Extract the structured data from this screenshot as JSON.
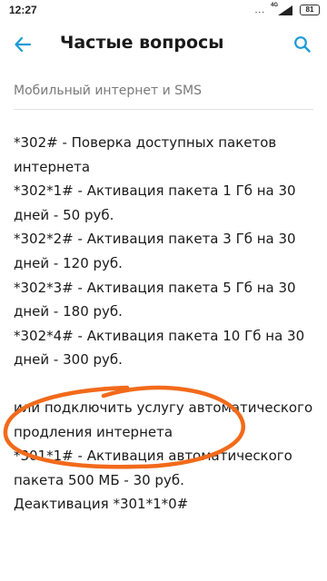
{
  "status_bar": {
    "time": "12:27",
    "dots": "...",
    "network": "4G",
    "battery": "81"
  },
  "header": {
    "title": "Частые вопросы",
    "back_icon": "arrow-left-icon",
    "search_icon": "search-icon",
    "accent_color": "#1a9bd7"
  },
  "section_title": "Мобильный интернет и SMS",
  "faq": {
    "block1": [
      "*302# - Поверка доступных пакетов интернета",
      "*302*1# - Активация пакета 1 Гб на 30 дней - 50 руб.",
      "*302*2# - Активация пакета 3 Гб на 30 дней - 120 руб.",
      "*302*3# - Активация пакета 5 Гб на 30 дней - 180 руб.",
      "*302*4# - Активация пакета 10 Гб на 30 дней - 300 руб."
    ],
    "highlighted": "или подключить услугу автоматического продления интернета",
    "block2": [
      "*301*1# - Активация автоматического пакета 500 МБ - 30 руб.",
      "Деактивация *301*1*0#"
    ],
    "highlight_color": "#f26a1b"
  }
}
